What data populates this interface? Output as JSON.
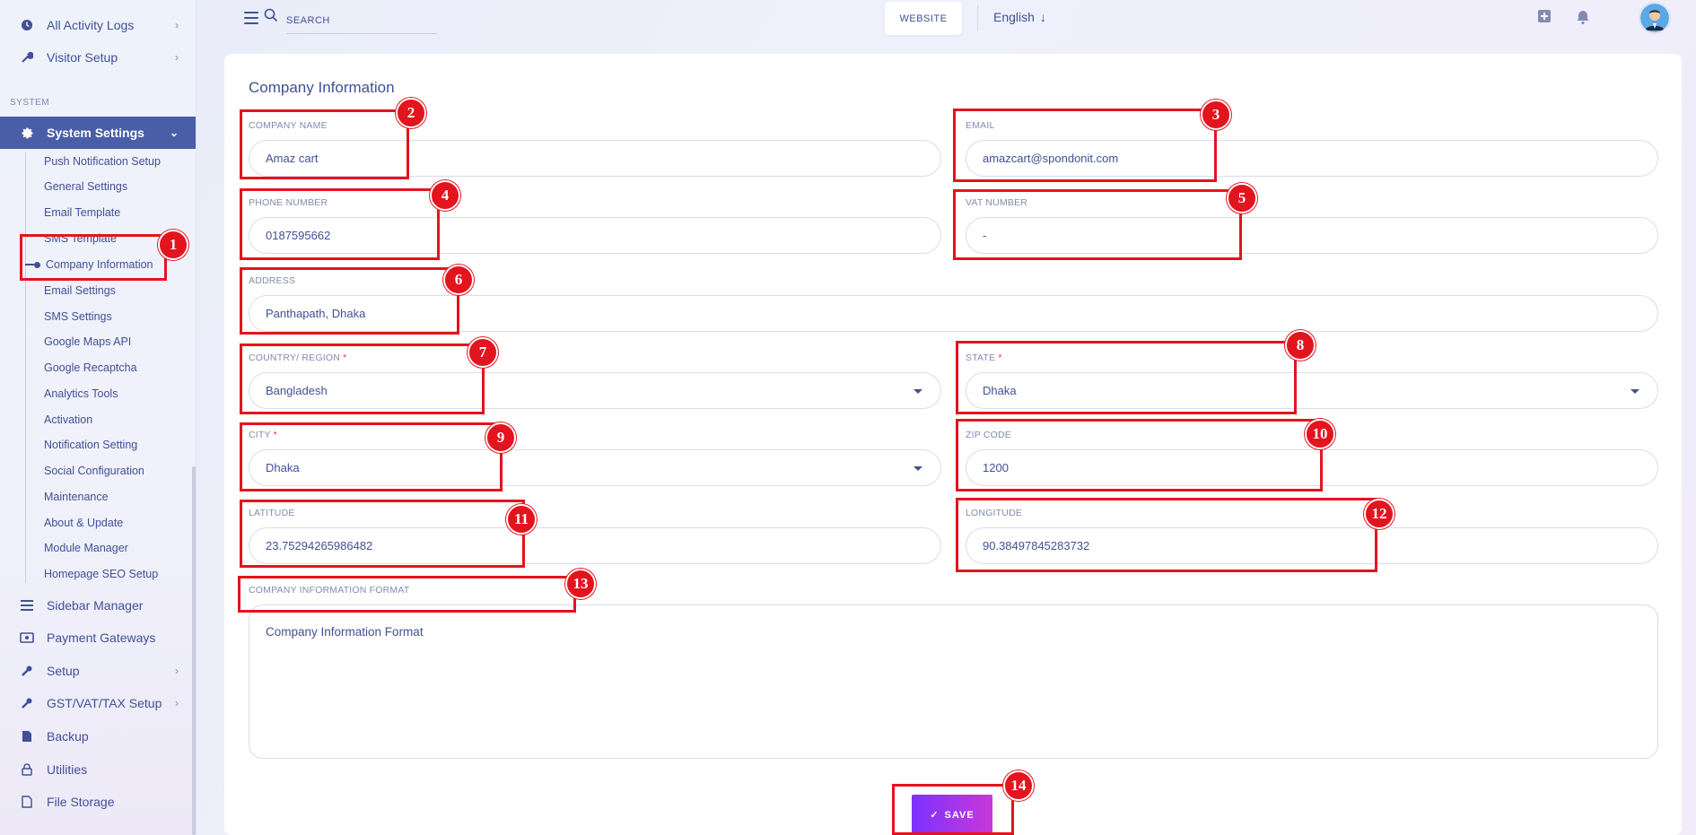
{
  "sidebar": {
    "top_items": [
      {
        "label": "All Activity Logs",
        "icon": "clock-icon",
        "has_chevron": true
      },
      {
        "label": "Visitor Setup",
        "icon": "wrench-icon",
        "has_chevron": true
      }
    ],
    "section_label": "SYSTEM",
    "active_item": {
      "label": "System Settings",
      "icon": "gear-icon"
    },
    "sub_items": [
      "Push Notification Setup",
      "General Settings",
      "Email Template",
      "SMS Template",
      "Company Information",
      "Email Settings",
      "SMS Settings",
      "Google Maps API",
      "Google Recaptcha",
      "Analytics Tools",
      "Activation",
      "Notification Setting",
      "Social Configuration",
      "Maintenance",
      "About & Update",
      "Module Manager",
      "Homepage SEO Setup"
    ],
    "current_sub_item": "Company Information",
    "bottom_items": [
      {
        "label": "Sidebar Manager",
        "icon": "list-icon",
        "has_chevron": false
      },
      {
        "label": "Payment Gateways",
        "icon": "money-icon",
        "has_chevron": false
      },
      {
        "label": "Setup",
        "icon": "wrench-icon",
        "has_chevron": true
      },
      {
        "label": "GST/VAT/TAX Setup",
        "icon": "wrench-icon",
        "has_chevron": true
      },
      {
        "label": "Backup",
        "icon": "file-icon",
        "has_chevron": false
      },
      {
        "label": "Utilities",
        "icon": "lock-icon",
        "has_chevron": false
      },
      {
        "label": "File Storage",
        "icon": "document-icon",
        "has_chevron": false
      }
    ]
  },
  "topbar": {
    "search_placeholder": "SEARCH",
    "website_label": "WEBSITE",
    "language": "English"
  },
  "form": {
    "title": "Company Information",
    "company_name": {
      "label": "COMPANY NAME",
      "value": "Amaz cart"
    },
    "email": {
      "label": "EMAIL",
      "value": "amazcart@spondonit.com"
    },
    "phone": {
      "label": "PHONE NUMBER",
      "value": "0187595662"
    },
    "vat": {
      "label": "VAT NUMBER",
      "value": "-"
    },
    "address": {
      "label": "ADDRESS",
      "value": "Panthapath, Dhaka"
    },
    "country": {
      "label": "COUNTRY/ REGION",
      "required": "*",
      "value": "Bangladesh"
    },
    "state": {
      "label": "STATE",
      "required": "*",
      "value": "Dhaka"
    },
    "city": {
      "label": "CITY",
      "required": "*",
      "value": "Dhaka"
    },
    "zip": {
      "label": "ZIP CODE",
      "value": "1200"
    },
    "latitude": {
      "label": "LATITUDE",
      "value": "23.75294265986482"
    },
    "longitude": {
      "label": "LONGITUDE",
      "value": "90.38497845283732"
    },
    "format": {
      "label": "COMPANY INFORMATION FORMAT",
      "value": "Company Information Format"
    },
    "save_label": "SAVE",
    "save_check": "✓"
  },
  "annotations": [
    "1",
    "2",
    "3",
    "4",
    "5",
    "6",
    "7",
    "8",
    "9",
    "10",
    "11",
    "12",
    "13",
    "14"
  ],
  "colors": {
    "accent": "#415094",
    "active_bg": "#4a5ea8",
    "annotation": "#e3141e",
    "save_start": "#7c32ff",
    "save_end": "#c738d8"
  }
}
